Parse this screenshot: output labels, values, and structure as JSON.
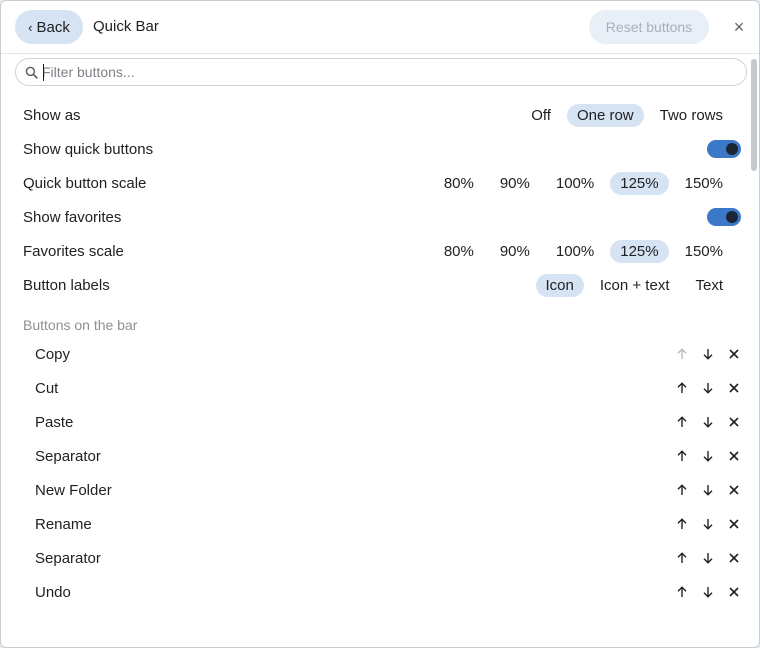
{
  "header": {
    "back_label": "Back",
    "back_chevron": "‹",
    "title": "Quick Bar",
    "reset_label": "Reset buttons",
    "close_glyph": "×"
  },
  "search": {
    "placeholder": "Filter buttons...",
    "value": ""
  },
  "settings": {
    "show_as": {
      "label": "Show as",
      "options": [
        "Off",
        "One row",
        "Two rows"
      ],
      "selected": "One row"
    },
    "show_quick_buttons": {
      "label": "Show quick buttons",
      "on": true
    },
    "quick_button_scale": {
      "label": "Quick button scale",
      "options": [
        "80%",
        "90%",
        "100%",
        "125%",
        "150%"
      ],
      "selected": "125%"
    },
    "show_favorites": {
      "label": "Show favorites",
      "on": true
    },
    "favorites_scale": {
      "label": "Favorites scale",
      "options": [
        "80%",
        "90%",
        "100%",
        "125%",
        "150%"
      ],
      "selected": "125%"
    },
    "button_labels": {
      "label": "Button labels",
      "options": [
        "Icon",
        "Icon + text",
        "Text"
      ],
      "selected": "Icon"
    }
  },
  "buttons_section": {
    "title": "Buttons on the bar",
    "items": [
      {
        "name": "Copy",
        "up_enabled": false
      },
      {
        "name": "Cut",
        "up_enabled": true
      },
      {
        "name": "Paste",
        "up_enabled": true
      },
      {
        "name": "Separator",
        "up_enabled": true
      },
      {
        "name": "New Folder",
        "up_enabled": true
      },
      {
        "name": "Rename",
        "up_enabled": true
      },
      {
        "name": "Separator",
        "up_enabled": true
      },
      {
        "name": "Undo",
        "up_enabled": true
      }
    ]
  },
  "icons": {
    "search": "search-icon",
    "up": "arrow-up-icon",
    "down": "arrow-down-icon",
    "remove": "close-icon",
    "toggle": "toggle-switch"
  },
  "colors": {
    "accent": "#3c78c8",
    "selected_bg": "#d5e3f3",
    "text": "#202124",
    "muted": "#8c9196"
  }
}
